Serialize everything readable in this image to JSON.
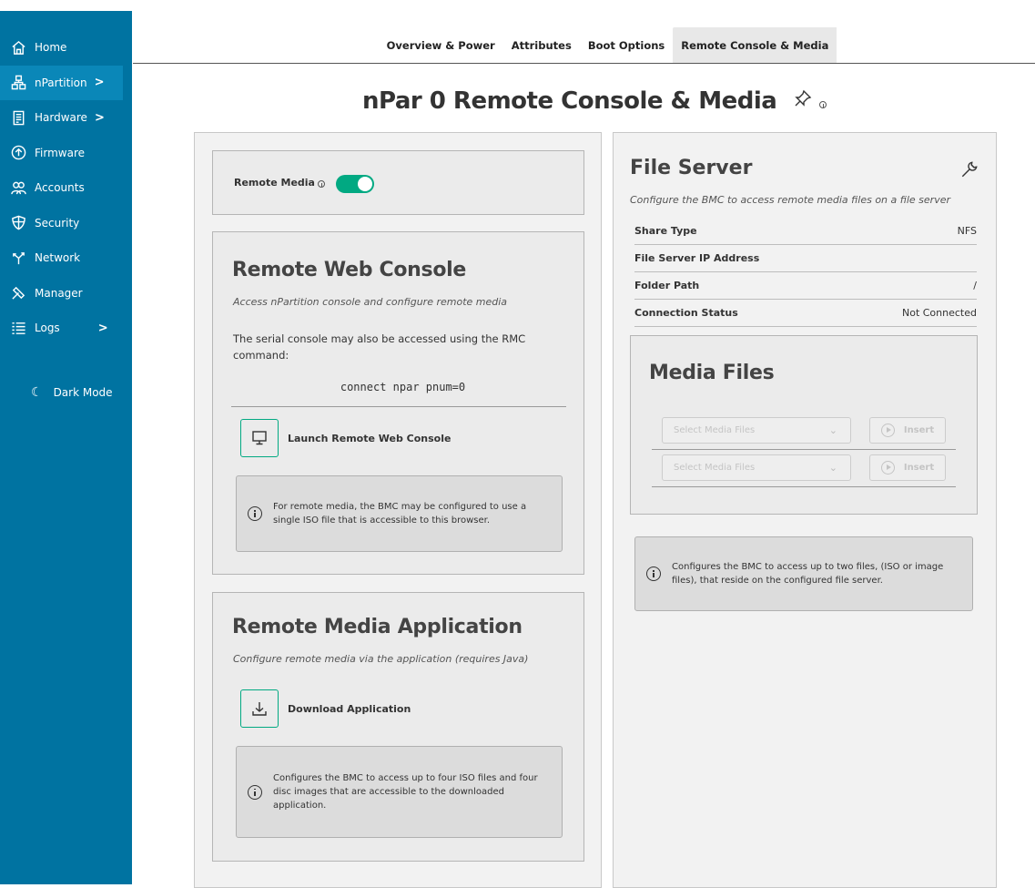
{
  "sidebar": {
    "items": [
      {
        "label": "Home",
        "icon": "home-icon"
      },
      {
        "label": "nPartition",
        "icon": "hierarchy-icon",
        "chevron": ">"
      },
      {
        "label": "Hardware",
        "icon": "document-icon",
        "chevron": ">"
      },
      {
        "label": "Firmware",
        "icon": "upload-circle-icon"
      },
      {
        "label": "Accounts",
        "icon": "group-icon"
      },
      {
        "label": "Security",
        "icon": "shield-icon"
      },
      {
        "label": "Network",
        "icon": "network-icon"
      },
      {
        "label": "Manager",
        "icon": "wrench-icon"
      },
      {
        "label": "Logs",
        "icon": "list-icon",
        "chevron": ">"
      }
    ],
    "dark_mode_label": "Dark Mode"
  },
  "tabs": [
    {
      "label": "Overview & Power"
    },
    {
      "label": "Attributes"
    },
    {
      "label": "Boot Options"
    },
    {
      "label": "Remote Console & Media",
      "active": true
    }
  ],
  "page": {
    "title": "nPar 0 Remote Console & Media"
  },
  "remote_media": {
    "label": "Remote Media",
    "enabled": true
  },
  "web_console": {
    "title": "Remote Web Console",
    "subtitle": "Access nPartition console and configure remote media",
    "body": "The serial console may also be accessed using the RMC command:",
    "command": "connect npar pnum=0",
    "launch_label": "Launch Remote Web Console",
    "info": "For remote media, the BMC may be configured to use a single ISO file that is accessible to this browser."
  },
  "media_app": {
    "title": "Remote Media Application",
    "subtitle": "Configure remote media via the application (requires Java)",
    "download_label": "Download Application",
    "info": "Configures the BMC to access up to four ISO files and four disc images that are accessible to the downloaded application."
  },
  "file_server": {
    "title": "File Server",
    "subtitle": "Configure the BMC to access remote media files on a file server",
    "rows": [
      {
        "key": "Share Type",
        "value": "NFS"
      },
      {
        "key": "File Server IP Address",
        "value": ""
      },
      {
        "key": "Folder Path",
        "value": "/"
      },
      {
        "key": "Connection Status",
        "value": "Not Connected"
      }
    ]
  },
  "media_files": {
    "title": "Media Files",
    "select_placeholder": "Select Media Files",
    "insert_label": "Insert",
    "info": "Configures the BMC to access up to two files, (ISO or image files), that reside on the configured file server."
  },
  "colors": {
    "sidebar": "#0073a1",
    "accent": "#01a982"
  }
}
